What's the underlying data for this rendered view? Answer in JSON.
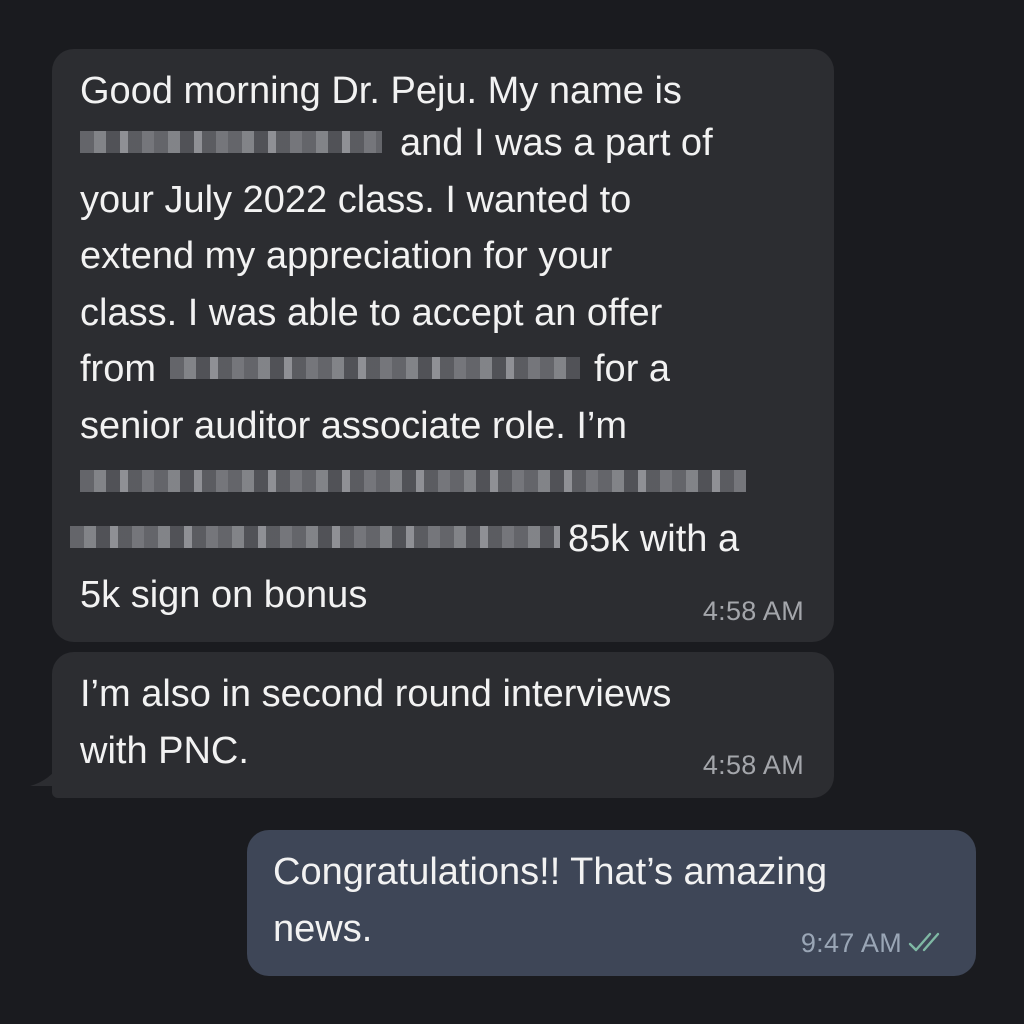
{
  "messages": [
    {
      "direction": "incoming",
      "lines": [
        "Good morning Dr. Peju. My name is",
        "and I was a part of",
        "your July 2022 class. I wanted to",
        "extend my appreciation for your",
        "class. I was able to accept an offer",
        "from",
        "for a",
        "senior auditor associate role. I’m",
        "85k with a",
        "5k sign on bonus"
      ],
      "time": "4:58 AM"
    },
    {
      "direction": "incoming",
      "lines": [
        "I’m also in second round interviews",
        "with PNC."
      ],
      "time": "4:58 AM"
    },
    {
      "direction": "outgoing",
      "lines": [
        "Congratulations!! That’s amazing",
        "news."
      ],
      "time": "9:47 AM",
      "status_icon": "double-check-icon"
    }
  ],
  "colors": {
    "background": "#1a1b1f",
    "incoming_bubble": "#2c2d31",
    "outgoing_bubble": "#3e4657",
    "read_check": "#7fb8a4"
  }
}
